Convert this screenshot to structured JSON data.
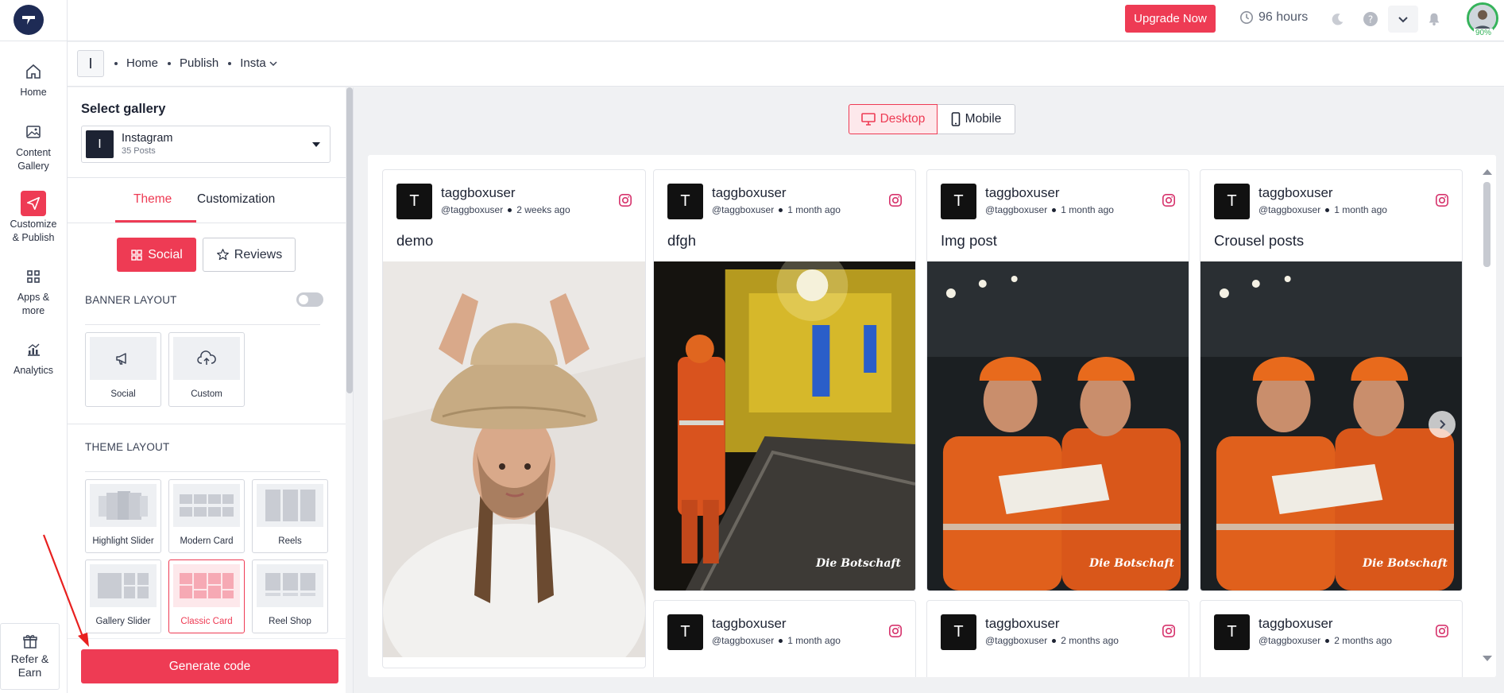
{
  "topbar": {
    "upgrade_label": "Upgrade Now",
    "hours_label": "96 hours",
    "profile_progress": "90%"
  },
  "nav": {
    "items": [
      {
        "label": "Home",
        "icon": "home-icon"
      },
      {
        "label": "Content Gallery",
        "icon": "image-icon"
      },
      {
        "label": "Customize & Publish",
        "icon": "send-icon"
      },
      {
        "label": "Apps & more",
        "icon": "grid-icon"
      },
      {
        "label": "Analytics",
        "icon": "chart-icon"
      }
    ],
    "refer_label": "Refer & Earn"
  },
  "breadcrumb": {
    "badge": "I",
    "items": [
      "Home",
      "Publish",
      "Insta"
    ]
  },
  "panel": {
    "select_gallery_title": "Select gallery",
    "gallery": {
      "badge": "I",
      "name": "Instagram",
      "posts": "35 Posts"
    },
    "tabs": [
      "Theme",
      "Customization"
    ],
    "pills": {
      "social": "Social",
      "reviews": "Reviews"
    },
    "banner_layout_label": "BANNER LAYOUT",
    "banner_toggle_on": false,
    "banner_tiles": [
      "Social",
      "Custom"
    ],
    "theme_layout_label": "THEME LAYOUT",
    "theme_tiles": [
      "Highlight Slider",
      "Modern Card",
      "Reels",
      "Gallery Slider",
      "Classic Card",
      "Reel Shop"
    ],
    "selected_theme": "Classic Card",
    "generate_label": "Generate code"
  },
  "preview": {
    "view_desktop": "Desktop",
    "view_mobile": "Mobile",
    "cards": [
      {
        "avatar": "T",
        "user": "taggboxuser",
        "handle": "@taggboxuser",
        "time": "2 weeks ago",
        "caption": "demo"
      },
      {
        "avatar": "T",
        "user": "taggboxuser",
        "handle": "@taggboxuser",
        "time": "1 month ago",
        "caption": "dfgh",
        "watermark": "Die Botschaft"
      },
      {
        "avatar": "T",
        "user": "taggboxuser",
        "handle": "@taggboxuser",
        "time": "1 month ago",
        "caption": "Img post",
        "watermark": "Die Botschaft"
      },
      {
        "avatar": "T",
        "user": "taggboxuser",
        "handle": "@taggboxuser",
        "time": "1 month ago",
        "caption": "Crousel posts",
        "watermark": "Die Botschaft"
      },
      {
        "avatar": "T",
        "user": "taggboxuser",
        "handle": "@taggboxuser",
        "time": "1 month ago",
        "caption": ""
      },
      {
        "avatar": "T",
        "user": "taggboxuser",
        "handle": "@taggboxuser",
        "time": "2 months ago",
        "caption": ""
      },
      {
        "avatar": "T",
        "user": "taggboxuser",
        "handle": "@taggboxuser",
        "time": "2 months ago",
        "caption": ""
      }
    ]
  },
  "colors": {
    "accent": "#ee3b54",
    "nav_dark": "#1e2b55",
    "success": "#35b35a"
  }
}
